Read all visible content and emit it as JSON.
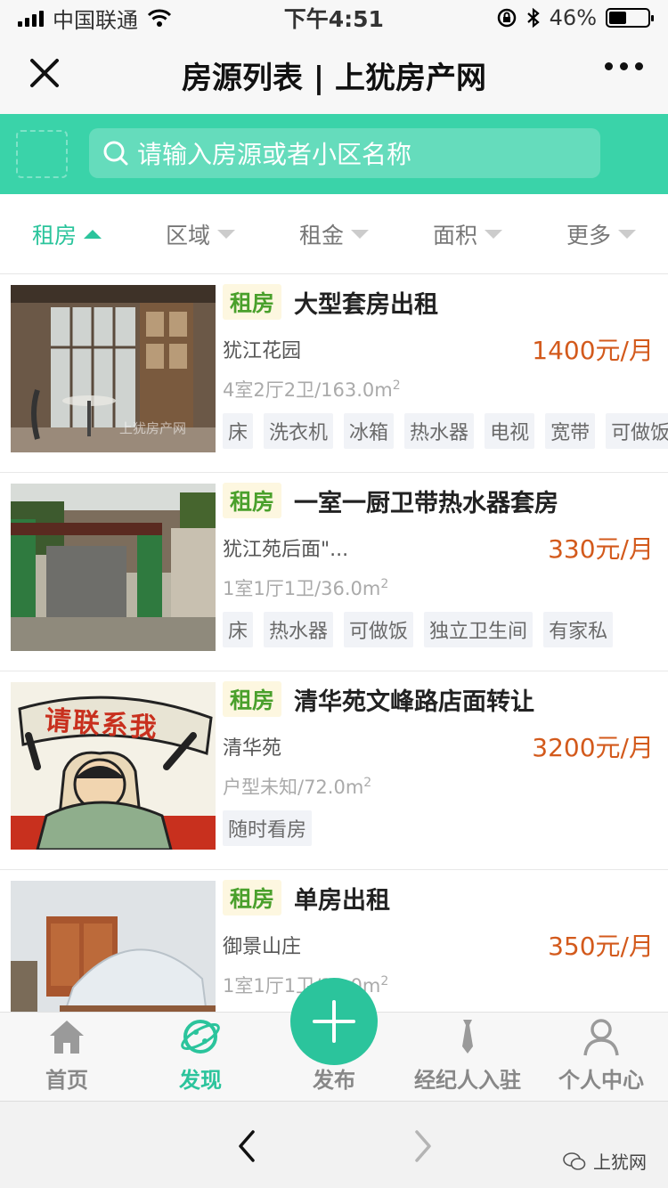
{
  "status_bar": {
    "carrier": "中国联通",
    "time": "下午4:51",
    "battery_pct": "46%",
    "battery_level": 0.46,
    "icons": [
      "signal-icon",
      "wifi-icon",
      "orientation-lock-icon",
      "bluetooth-icon",
      "battery-icon"
    ]
  },
  "nav": {
    "title": "房源列表 | 上犹房产网",
    "close_icon": "close-icon",
    "more_icon": "more-icon"
  },
  "search": {
    "placeholder": "请输入房源或者小区名称",
    "icon": "search-icon"
  },
  "filters": [
    {
      "label": "租房",
      "active": true
    },
    {
      "label": "区域",
      "active": false
    },
    {
      "label": "租金",
      "active": false
    },
    {
      "label": "面积",
      "active": false
    },
    {
      "label": "更多",
      "active": false
    }
  ],
  "listings": [
    {
      "tag": "租房",
      "title": "大型套房出租",
      "community": "犹江花园",
      "price": "1400元/月",
      "spec": "4室2厅2卫/163.0m",
      "spec_sup": "2",
      "features": [
        "床",
        "洗衣机",
        "冰箱",
        "热水器",
        "电视",
        "宽带",
        "可做饭"
      ],
      "image": "interior-room-photo",
      "watermark": "上犹房产网"
    },
    {
      "tag": "租房",
      "title": "一室一厨卫带热水器套房",
      "community": "犹江苑后面\"...",
      "price": "330元/月",
      "spec": "1室1厅1卫/36.0m",
      "spec_sup": "2",
      "features": [
        "床",
        "热水器",
        "可做饭",
        "独立卫生间",
        "有家私"
      ],
      "image": "building-gate-photo"
    },
    {
      "tag": "租房",
      "title": "清华苑文峰路店面转让",
      "community": "清华苑",
      "price": "3200元/月",
      "spec": "户型未知/72.0m",
      "spec_sup": "2",
      "features": [
        "随时看房"
      ],
      "image": "poster-illustration",
      "banner_text": "请联系我"
    },
    {
      "tag": "租房",
      "title": "单房出租",
      "community": "御景山庄",
      "price": "350元/月",
      "spec": "1室1厅1卫/30.0m",
      "spec_sup": "2",
      "features": [],
      "image": "bedroom-photo"
    }
  ],
  "tabs": [
    {
      "label": "首页",
      "icon": "home-icon",
      "active": false
    },
    {
      "label": "发现",
      "icon": "discover-icon",
      "active": true
    },
    {
      "label": "发布",
      "icon": "plus-icon",
      "active": false
    },
    {
      "label": "经纪人入驻",
      "icon": "agent-icon",
      "active": false
    },
    {
      "label": "个人中心",
      "icon": "user-icon",
      "active": false
    }
  ],
  "browser": {
    "back_icon": "back-arrow-icon",
    "forward_icon": "forward-arrow-icon",
    "watermark": "上犹网",
    "watermark_icon": "wechat-icon"
  },
  "colors": {
    "accent": "#2bc49c",
    "search_band": "#3ad3a9",
    "price": "#d35a1c",
    "tag_text": "#4aa02c",
    "tag_bg": "#fdf7e0"
  }
}
